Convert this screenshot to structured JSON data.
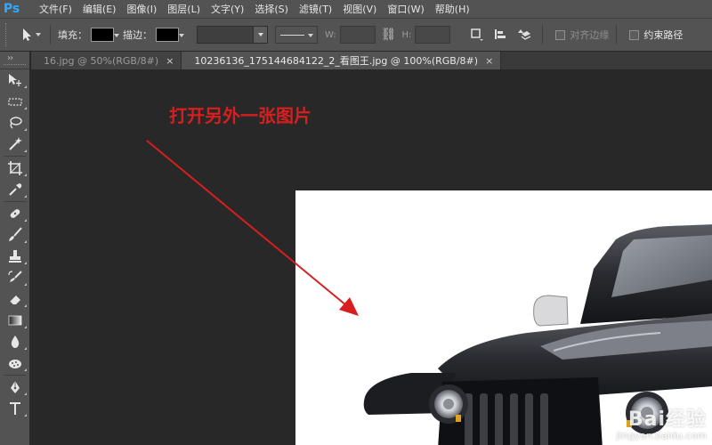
{
  "app": {
    "logo": "Ps"
  },
  "menu": [
    "文件(F)",
    "编辑(E)",
    "图像(I)",
    "图层(L)",
    "文字(Y)",
    "选择(S)",
    "滤镜(T)",
    "视图(V)",
    "窗口(W)",
    "帮助(H)"
  ],
  "options": {
    "fill_label": "填充：",
    "stroke_label": "描边：",
    "width_label": "W:",
    "height_label": "H:",
    "align_edges_label": "对齐边缘",
    "constrain_path_label": "约束路径",
    "fill_color": "#000000",
    "stroke_color": "#000000"
  },
  "tabs": [
    {
      "label": "16.jpg @ 50%(RGB/8#)",
      "close": "×",
      "active": false
    },
    {
      "label": "10236136_175144684122_2_看图王.jpg @ 100%(RGB/8#)",
      "close": "×",
      "active": true
    }
  ],
  "tools": [
    "move-tool",
    "marquee-tool",
    "lasso-tool",
    "magic-wand-tool",
    "crop-tool",
    "eyedropper-tool",
    "spot-healing-tool",
    "brush-tool",
    "clone-stamp-tool",
    "history-brush-tool",
    "eraser-tool",
    "gradient-tool",
    "blur-tool",
    "dodge-tool",
    "pen-tool",
    "type-tool"
  ],
  "annotation": {
    "text": "打开另外一张图片",
    "color": "#d81e1e"
  },
  "watermark": {
    "logo": "Bai经验",
    "url": "jingyan.baidu.com"
  },
  "colors": {
    "ui_panel": "#535353",
    "workspace": "#282828",
    "accent_logo": "#31a8ff"
  }
}
